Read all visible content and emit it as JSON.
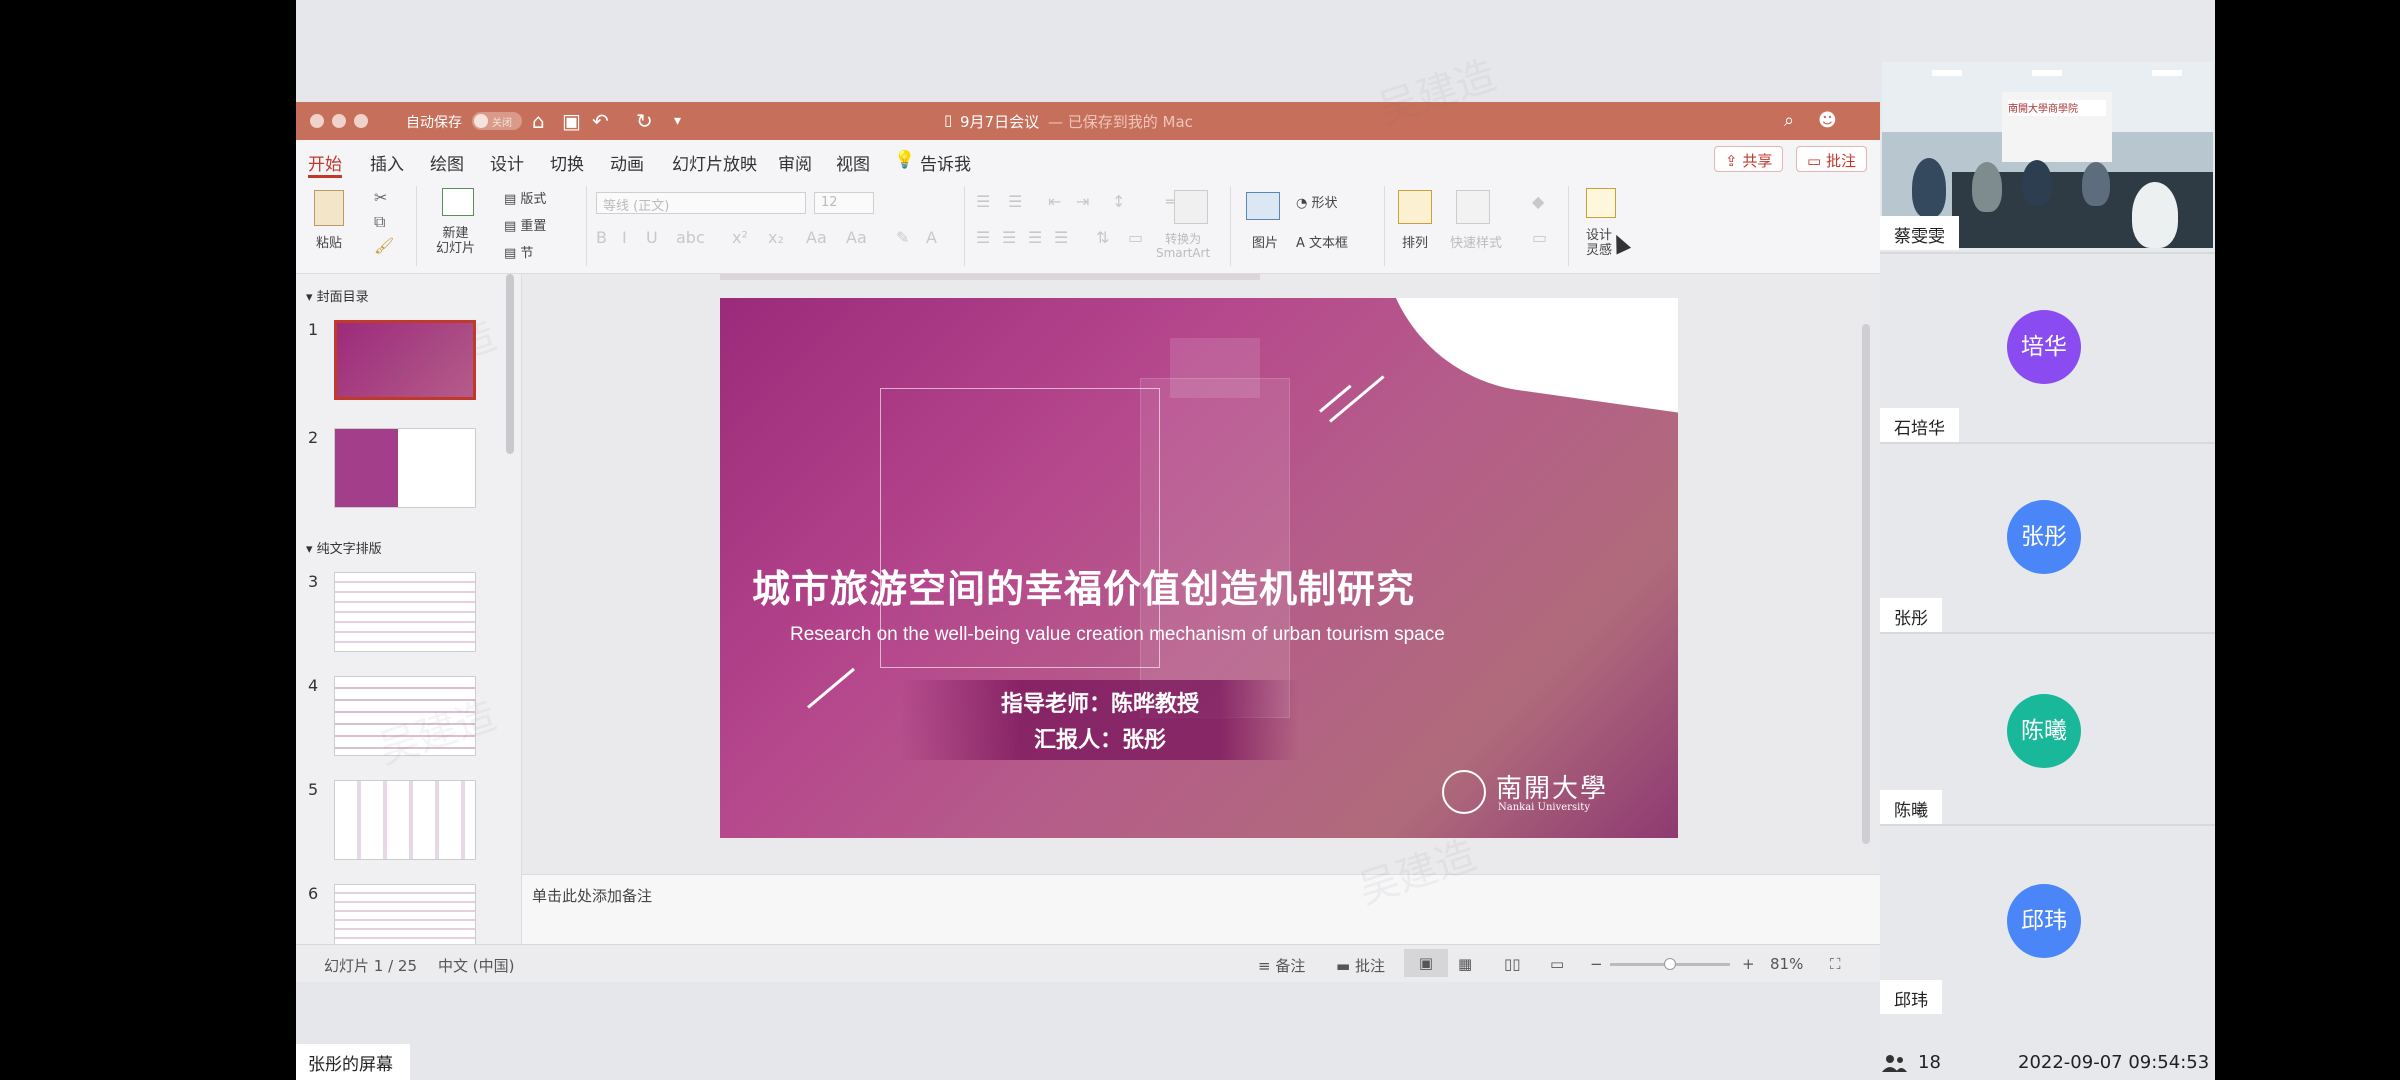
{
  "window": {
    "autosave_label": "自动保存",
    "autosave_state": "关闭",
    "doc_title": "9月7日会议",
    "doc_status": "— 已保存到我的 Mac"
  },
  "tabs": [
    "开始",
    "插入",
    "绘图",
    "设计",
    "切换",
    "动画",
    "幻灯片放映",
    "审阅",
    "视图"
  ],
  "tell_me": "告诉我",
  "share_label": "共享",
  "comments_label": "批注",
  "ribbon": {
    "paste": "粘贴",
    "new_slide": "新建\n幻灯片",
    "layout": "版式",
    "reset": "重置",
    "section": "节",
    "font_name": "等线 (正文)",
    "font_size": "12",
    "convert_smartart": "转换为\nSmartArt",
    "picture": "图片",
    "shapes": "形状",
    "textbox": "文本框",
    "arrange": "排列",
    "quick_styles": "快速样式",
    "designer": "设计\n灵感"
  },
  "slide_panel": {
    "sections": [
      "封面目录",
      "纯文字排版"
    ],
    "slide_numbers": [
      "1",
      "2",
      "3",
      "4",
      "5",
      "6"
    ]
  },
  "slide": {
    "title": "城市旅游空间的幸福价值创造机制研究",
    "subtitle": "Research on the well-being value creation mechanism of urban tourism space",
    "advisor": "指导老师：陈晔教授",
    "reporter": "汇报人：张彤",
    "logo_cn": "南開大學",
    "logo_en": "Nankai University"
  },
  "notes_placeholder": "单击此处添加备注",
  "status_bar": {
    "slide_count": "幻灯片 1 / 25",
    "language": "中文 (中国)",
    "notes": "备注",
    "comments": "批注",
    "zoom": "81%",
    "zoom_level": 0.5
  },
  "screen_share_label": "张彤的屏幕",
  "participants": [
    {
      "name": "蔡雯雯",
      "avatar": null
    },
    {
      "name": "石培华",
      "avatar": "培华",
      "color": "#8a4cf0"
    },
    {
      "name": "张彤",
      "avatar": "张彤",
      "color": "#4a86f7"
    },
    {
      "name": "陈曦",
      "avatar": "陈曦",
      "color": "#19b89a"
    },
    {
      "name": "邱玮",
      "avatar": "邱玮",
      "color": "#4a86f7"
    }
  ],
  "video_banner": "南開大學商學院",
  "participant_count": "18",
  "timestamp": "2022-09-07 09:54:53",
  "watermark": "吴建造"
}
